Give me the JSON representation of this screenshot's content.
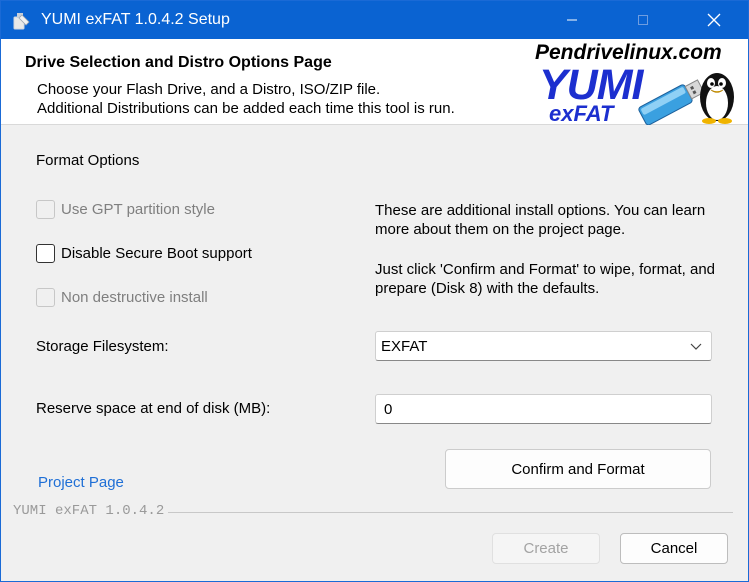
{
  "window": {
    "title": "YUMI exFAT 1.0.4.2 Setup",
    "accent_color": "#0a63d2",
    "controls": [
      "minimize-icon",
      "maximize-icon",
      "close-icon"
    ]
  },
  "header": {
    "title": "Drive Selection and Distro Options Page",
    "line1": "Choose your Flash Drive, and a Distro, ISO/ZIP file.",
    "line2": "Additional Distributions can be added each time this tool is run.",
    "logo": {
      "site": "Pendrivelinux.com",
      "brand": "YUMI",
      "sub": "exFAT",
      "brand_color": "#1c2fcf"
    }
  },
  "format_options": {
    "label": "Format Options",
    "checkboxes": [
      {
        "label": "Use GPT partition style",
        "checked": false,
        "enabled": false
      },
      {
        "label": "Disable Secure Boot support",
        "checked": false,
        "enabled": true
      },
      {
        "label": "Non destructive install",
        "checked": false,
        "enabled": false
      }
    ]
  },
  "info": {
    "para1": "These are additional install options. You can learn more about them on the project page.",
    "para2": "Just click 'Confirm and Format' to wipe, format, and prepare (Disk 8) with the defaults."
  },
  "storage": {
    "label": "Storage Filesystem:",
    "selected": "EXFAT"
  },
  "reserve": {
    "label": "Reserve space at end of disk (MB):",
    "value": "0"
  },
  "project_link": "Project Page",
  "buttons": {
    "confirm": "Confirm and Format",
    "create": "Create",
    "cancel": "Cancel"
  },
  "version_label": "YUMI exFAT 1.0.4.2"
}
